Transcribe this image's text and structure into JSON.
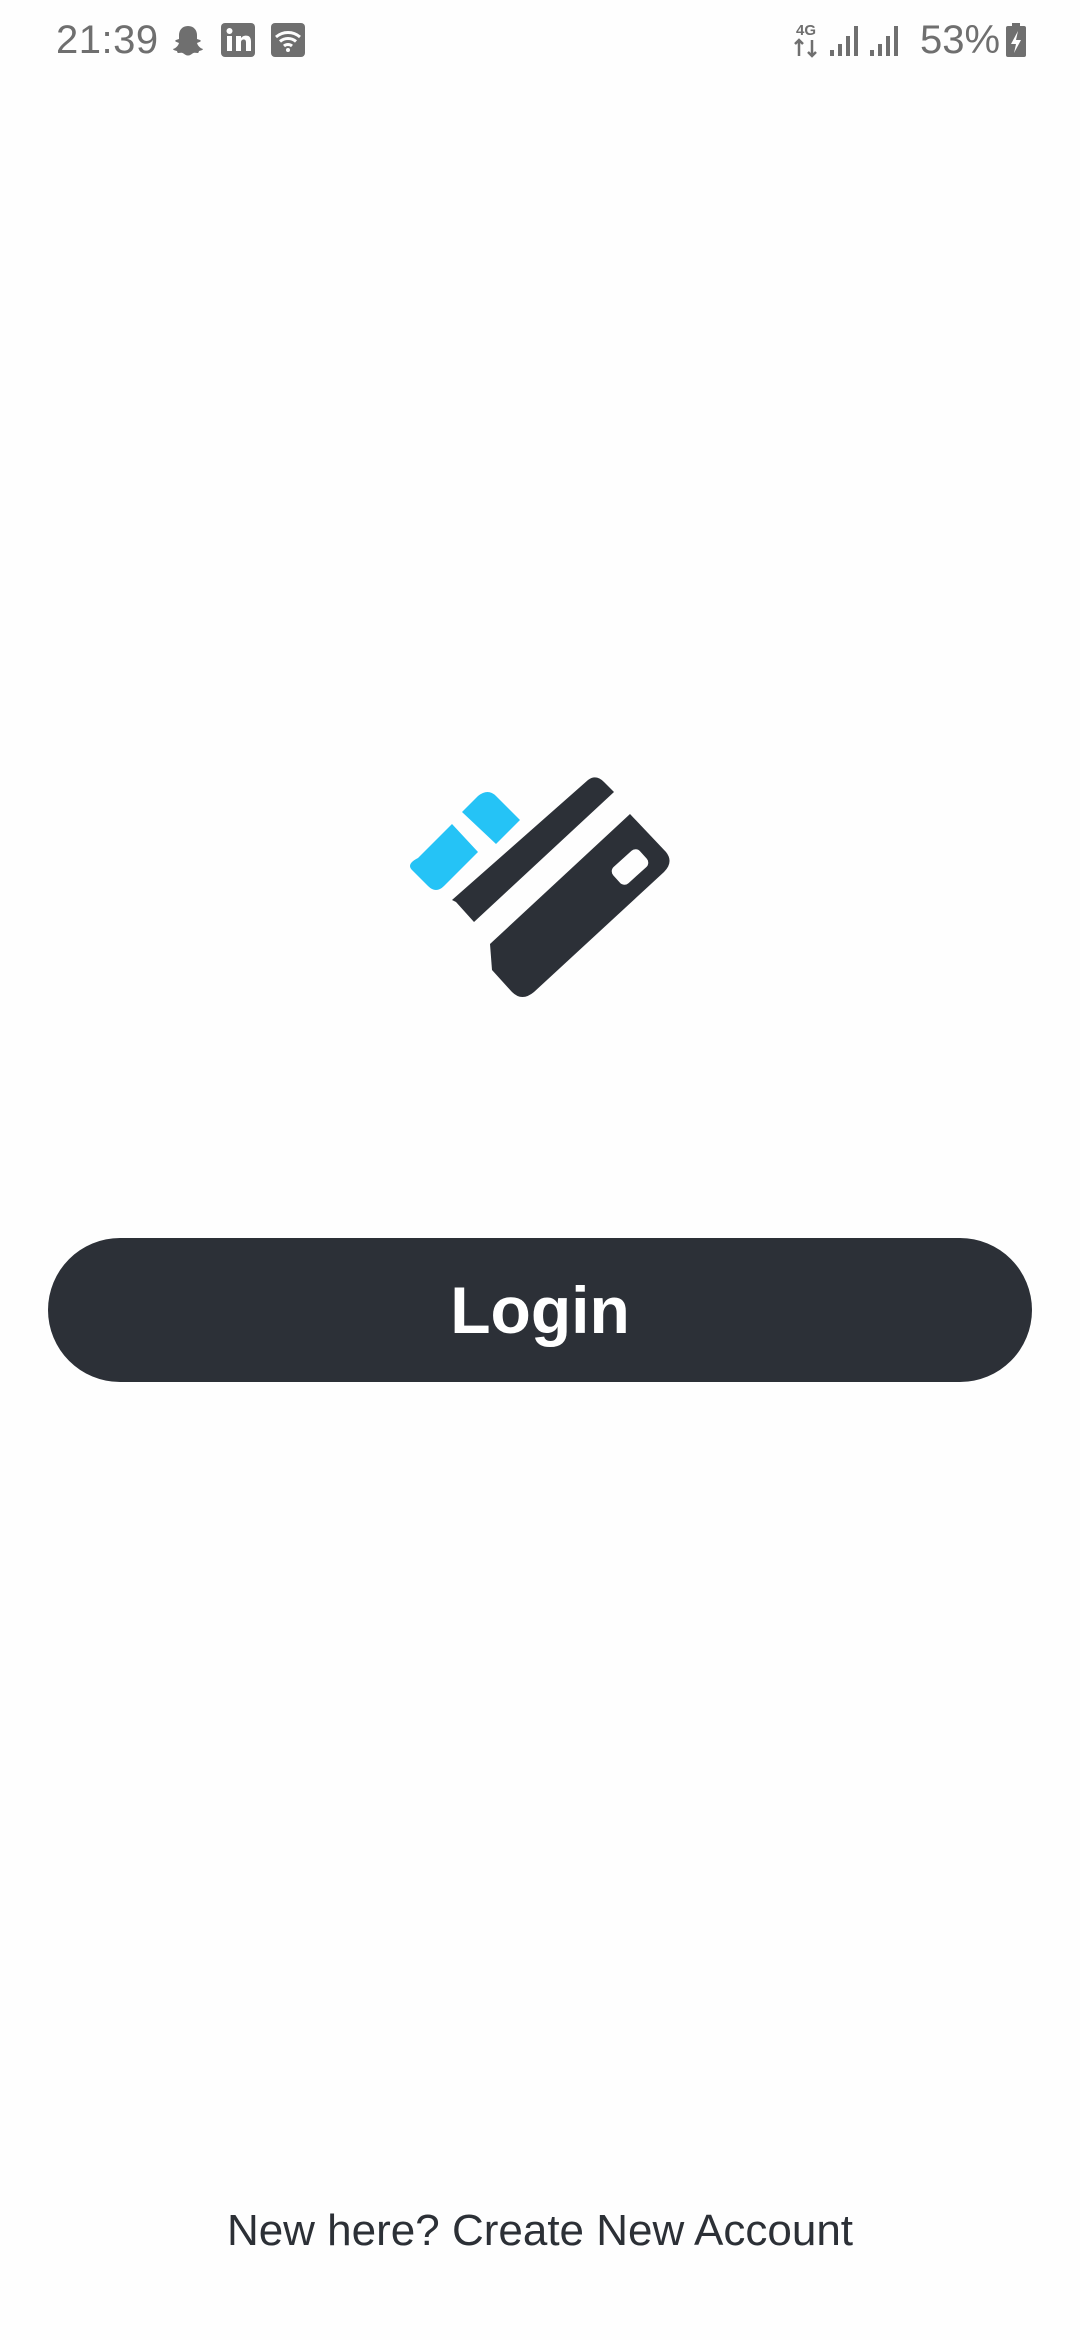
{
  "status_bar": {
    "time": "21:39",
    "left_icons": [
      "snapchat-icon",
      "linkedin-icon",
      "wifi-app-icon"
    ],
    "network_label": "4G",
    "right_icons": [
      "net-4g-icon",
      "signal-icon",
      "signal-icon",
      "battery-charging-icon"
    ],
    "battery_percent": "53%"
  },
  "logo": {
    "icon": "credit-card-logo-icon",
    "colors": {
      "accent": "#25c3f6",
      "dark": "#2c3037"
    }
  },
  "login": {
    "label": "Login",
    "background": "#2c3037",
    "text_color": "#ffffff"
  },
  "footer": {
    "create_account_label": "New here? Create New Account"
  }
}
